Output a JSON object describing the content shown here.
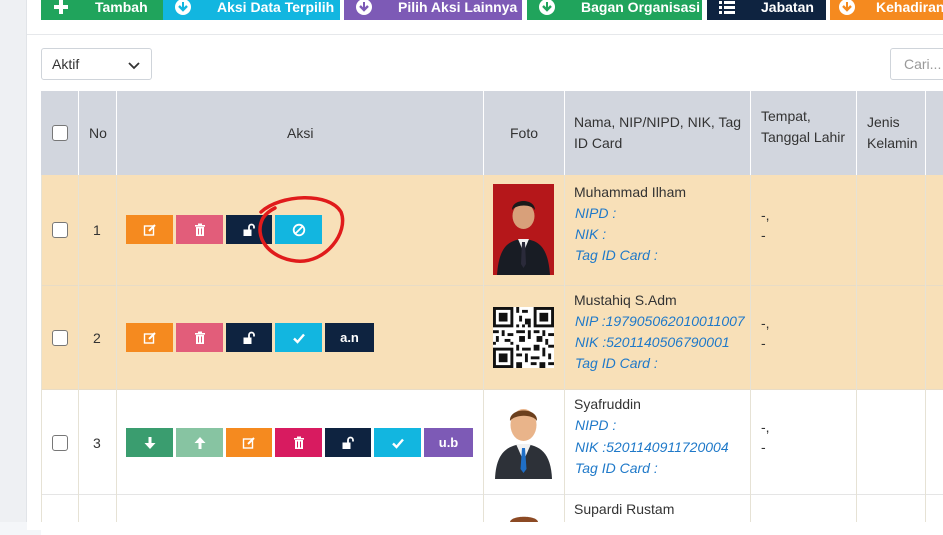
{
  "colors": {
    "green": "#20a45c",
    "cyan": "#12b6e0",
    "purple": "#7d5ab6",
    "navy": "#0e2340",
    "orange": "#f58a1f",
    "pink": "#e25d7a",
    "magenta": "#d81b60",
    "sea_green": "#3a9d6f",
    "light_green": "#87c4a2",
    "row_highlight": "#f8e0b8",
    "row_plain": "#ffffff",
    "header_bg": "#d2d6de",
    "link": "#1f79c9",
    "annotation_red": "#e01b1b"
  },
  "toolbar": {
    "buttons": [
      {
        "label": "Tambah",
        "icon": "plus-icon",
        "color": "#20a45c"
      },
      {
        "label": "Aksi Data Terpilih",
        "icon": "arrow-down-circle-icon",
        "color": "#12b6e0"
      },
      {
        "label": "Pilih Aksi Lainnya",
        "icon": "arrow-down-circle-icon",
        "color": "#7d5ab6"
      },
      {
        "label": "Bagan Organisasi",
        "icon": "arrow-down-circle-icon",
        "color": "#20a45c"
      },
      {
        "label": "Jabatan",
        "icon": "list-icon",
        "color": "#0e2340"
      },
      {
        "label": "Kehadiran",
        "icon": "arrow-down-circle-icon",
        "color": "#f58a1f"
      }
    ]
  },
  "filter": {
    "status_value": "Aktif"
  },
  "search": {
    "placeholder": "Cari..."
  },
  "table": {
    "headers": {
      "no": "No",
      "aksi": "Aksi",
      "foto": "Foto",
      "nama_line1": "Nama, NIP/NIPD, NIK, Tag",
      "nama_line2": "ID Card",
      "ttl_line1": "Tempat,",
      "ttl_line2": "Tanggal Lahir",
      "jk_line1": "Jenis",
      "jk_line2": "Kelamin"
    },
    "rows": [
      {
        "no": "1",
        "name": "Muhammad Ilham",
        "nip": "NIPD :",
        "nik": "NIK :",
        "tag": "Tag ID Card :",
        "ttl_1": "-,",
        "ttl_2": "-",
        "actions": [
          "edit-icon",
          "trash-icon",
          "unlock-icon",
          "ban-icon"
        ]
      },
      {
        "no": "2",
        "name": "Mustahiq S.Adm",
        "nip": "NIP :197905062010011007",
        "nik": "NIK :5201140506790001",
        "tag": "Tag ID Card :",
        "ttl_1": "-,",
        "ttl_2": "-",
        "actions": [
          "edit-icon",
          "trash-icon",
          "unlock-icon",
          "check-icon",
          "a.n"
        ]
      },
      {
        "no": "3",
        "name": "Syafruddin",
        "nip": "NIPD :",
        "nik": "NIK :5201140911720004",
        "tag": "Tag ID Card :",
        "ttl_1": "-,",
        "ttl_2": "-",
        "actions": [
          "arrow-down-icon",
          "arrow-up-icon",
          "edit-icon",
          "trash-icon",
          "unlock-icon",
          "check-icon",
          "u.b"
        ]
      },
      {
        "no": "",
        "name": "Supardi Rustam"
      }
    ],
    "button_labels": {
      "an": "a.n",
      "ub": "u.b"
    }
  }
}
